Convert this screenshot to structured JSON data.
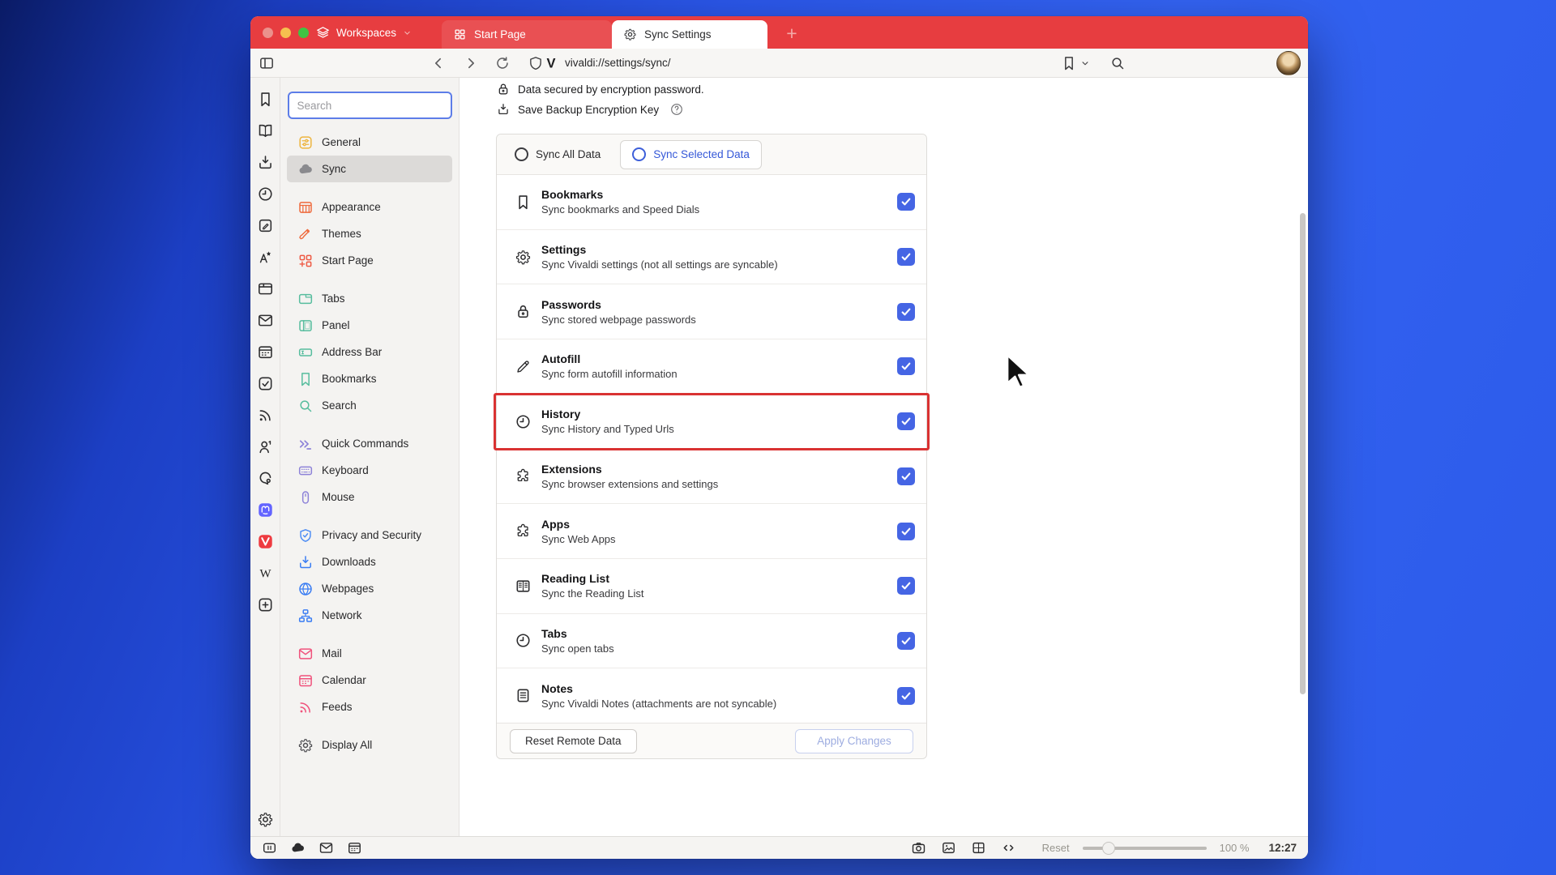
{
  "titlebar": {
    "workspaces_label": "Workspaces",
    "tabs": [
      {
        "label": "Start Page"
      },
      {
        "label": "Sync Settings"
      }
    ]
  },
  "toolbar": {
    "url": "vivaldi://settings/sync/"
  },
  "panel_strip": {
    "icons": [
      "bookmark",
      "reading-list",
      "download",
      "history",
      "notes",
      "translate",
      "window",
      "mail",
      "calendar",
      "tasks",
      "feeds",
      "contacts",
      "chat",
      "mastodon",
      "vivaldi",
      "wikipedia",
      "add-webpanel",
      "settings-gear"
    ]
  },
  "sidebar": {
    "search_placeholder": "Search",
    "groups": [
      {
        "items": [
          {
            "icon": "general",
            "label": "General",
            "color": "#edb53f"
          },
          {
            "icon": "sync",
            "label": "Sync",
            "color": "#8a8a8e",
            "selected": true
          }
        ]
      },
      {
        "items": [
          {
            "icon": "appearance",
            "label": "Appearance",
            "color": "#ee6a3c"
          },
          {
            "icon": "themes",
            "label": "Themes",
            "color": "#ee6a3c"
          },
          {
            "icon": "startpage",
            "label": "Start Page",
            "color": "#ee5a44"
          }
        ]
      },
      {
        "items": [
          {
            "icon": "tabs",
            "label": "Tabs",
            "color": "#57bd9e"
          },
          {
            "icon": "panel",
            "label": "Panel",
            "color": "#57bd9e"
          },
          {
            "icon": "addressbar",
            "label": "Address Bar",
            "color": "#57bd9e"
          },
          {
            "icon": "bookmark",
            "label": "Bookmarks",
            "color": "#57bd9e"
          },
          {
            "icon": "search",
            "label": "Search",
            "color": "#57bd9e"
          }
        ]
      },
      {
        "items": [
          {
            "icon": "quickcommands",
            "label": "Quick Commands",
            "color": "#8d82d8"
          },
          {
            "icon": "keyboard",
            "label": "Keyboard",
            "color": "#8d82d8"
          },
          {
            "icon": "mouse",
            "label": "Mouse",
            "color": "#8d82d8"
          }
        ]
      },
      {
        "items": [
          {
            "icon": "privacy",
            "label": "Privacy and Security",
            "color": "#4b8bf4"
          },
          {
            "icon": "download",
            "label": "Downloads",
            "color": "#3c7ef3"
          },
          {
            "icon": "webpages",
            "label": "Webpages",
            "color": "#3c7ef3"
          },
          {
            "icon": "network",
            "label": "Network",
            "color": "#3c7ef3"
          }
        ]
      },
      {
        "items": [
          {
            "icon": "mail",
            "label": "Mail",
            "color": "#f0527c"
          },
          {
            "icon": "calendar",
            "label": "Calendar",
            "color": "#f0527c"
          },
          {
            "icon": "feeds",
            "label": "Feeds",
            "color": "#f0527c"
          }
        ]
      },
      {
        "items": [
          {
            "icon": "settings-gear",
            "label": "Display All",
            "color": "#4c4c50"
          }
        ]
      }
    ]
  },
  "sync_page": {
    "encryption_status": "Data secured by encryption password.",
    "backup_link": "Save Backup Encryption Key",
    "mode_toggle": {
      "options": [
        {
          "label": "Sync All Data"
        },
        {
          "label": "Sync Selected Data",
          "selected": true
        }
      ]
    },
    "rows": [
      {
        "icon": "bookmark",
        "title": "Bookmarks",
        "subtitle": "Sync bookmarks and Speed Dials",
        "checked": true
      },
      {
        "icon": "gear",
        "title": "Settings",
        "subtitle": "Sync Vivaldi settings (not all settings are syncable)",
        "checked": true
      },
      {
        "icon": "lock",
        "title": "Passwords",
        "subtitle": "Sync stored webpage passwords",
        "checked": true
      },
      {
        "icon": "pencil",
        "title": "Autofill",
        "subtitle": "Sync form autofill information",
        "checked": true
      },
      {
        "icon": "clock",
        "title": "History",
        "subtitle": "Sync History and Typed Urls",
        "checked": true,
        "highlighted": true
      },
      {
        "icon": "puzzle",
        "title": "Extensions",
        "subtitle": "Sync browser extensions and settings",
        "checked": true
      },
      {
        "icon": "puzzle",
        "title": "Apps",
        "subtitle": "Sync Web Apps",
        "checked": true
      },
      {
        "icon": "book",
        "title": "Reading List",
        "subtitle": "Sync the Reading List",
        "checked": true
      },
      {
        "icon": "clock",
        "title": "Tabs",
        "subtitle": "Sync open tabs",
        "checked": true
      },
      {
        "icon": "note",
        "title": "Notes",
        "subtitle": "Sync Vivaldi Notes (attachments are not syncable)",
        "checked": true
      }
    ],
    "footer": {
      "reset_button": "Reset Remote Data",
      "apply_button": "Apply Changes"
    }
  },
  "statusbar": {
    "left_icons": [
      "panel-toggle-bars",
      "cloud",
      "mail",
      "calendar"
    ],
    "right_icons": [
      "camera",
      "image",
      "tiling",
      "code"
    ],
    "zoom_reset_label": "Reset",
    "zoom_level": "100 %",
    "clock": "12:27"
  },
  "colors": {
    "accent_red": "#e73d40",
    "checkbox_blue": "#4565e4",
    "highlight_red": "#d93232",
    "selected_text_blue": "#3558d8"
  }
}
